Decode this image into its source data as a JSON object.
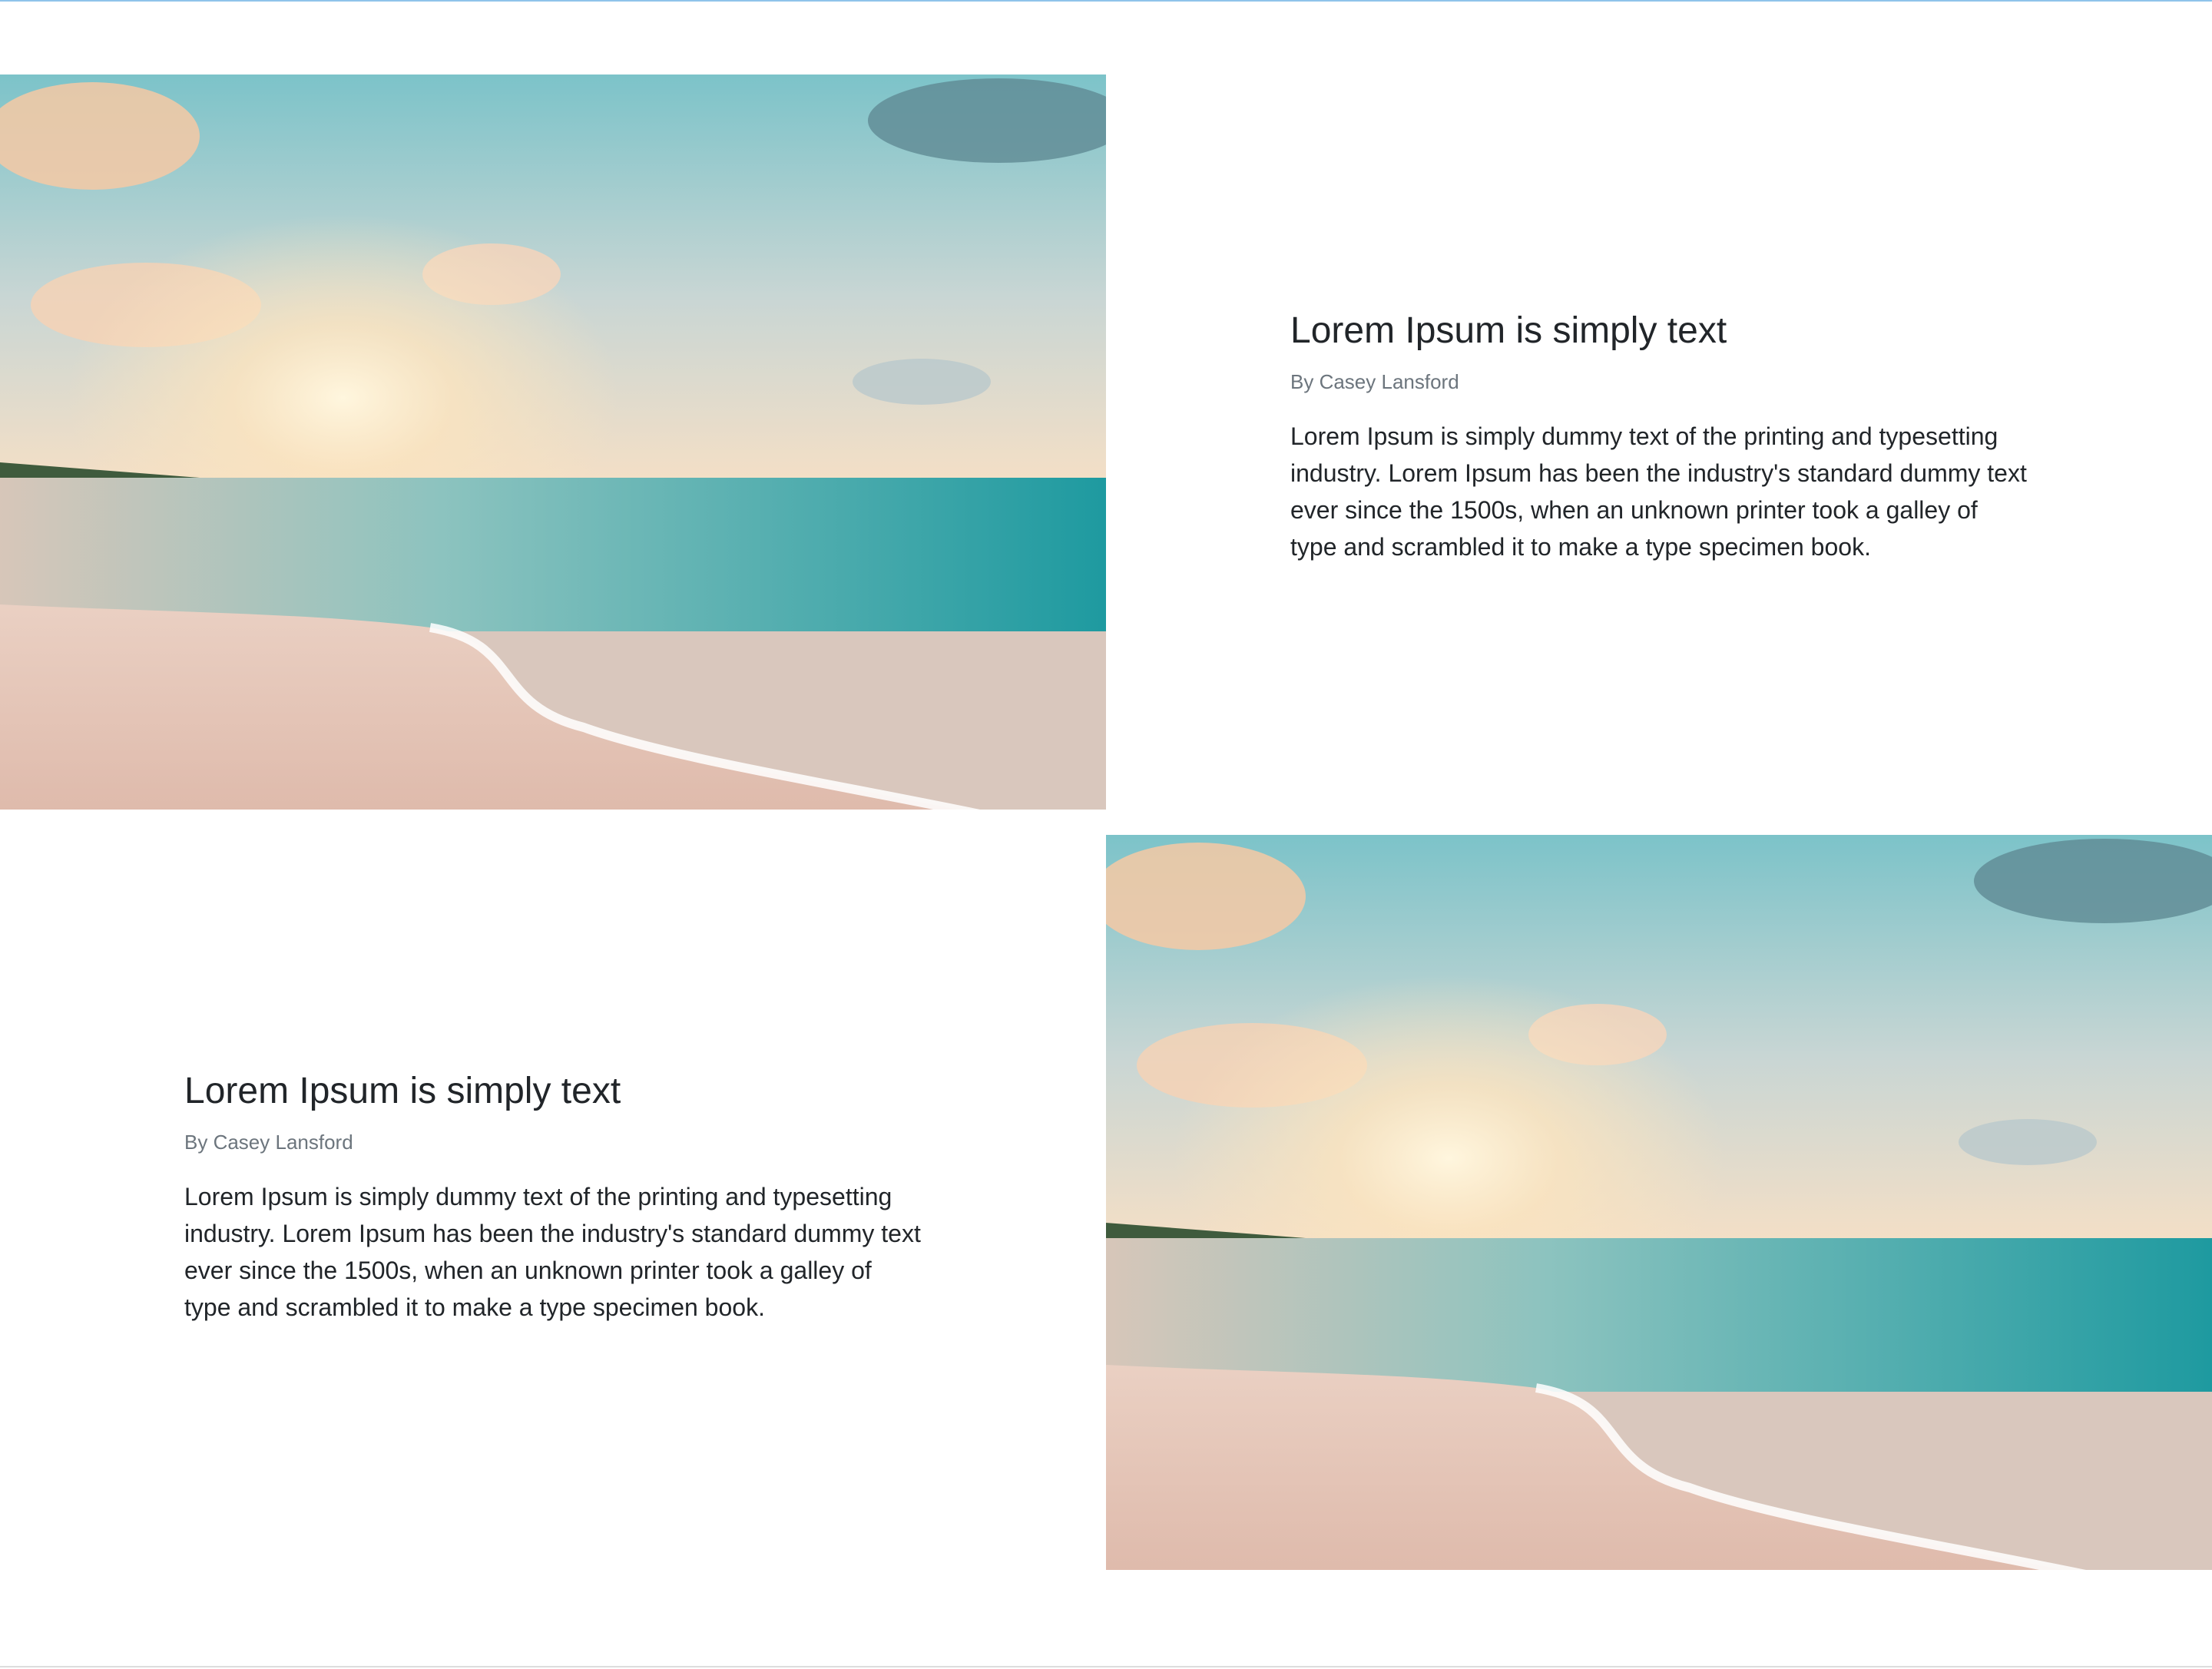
{
  "sections": [
    {
      "image_alt": "beach-sunset-photo",
      "title": "Lorem Ipsum is simply text",
      "author": "By Casey Lansford",
      "body": "Lorem Ipsum is simply dummy text of the printing and typesetting industry. Lorem Ipsum has been the industry's standard dummy text ever since the 1500s, when an unknown printer took a galley of type and scrambled it to make a type specimen book."
    },
    {
      "image_alt": "beach-sunset-photo",
      "title": "Lorem Ipsum is simply text",
      "author": "By Casey Lansford",
      "body": "Lorem Ipsum is simply dummy text of the printing and typesetting industry. Lorem Ipsum has been the industry's standard dummy text ever since the 1500s, when an unknown printer took a galley of type and scrambled it to make a type specimen book."
    }
  ],
  "colors": {
    "heading": "#212529",
    "muted": "#6c757d",
    "sky_top": "#6fc0c8",
    "sea": "#2aa3a6",
    "sand": "#e8c4b3"
  }
}
